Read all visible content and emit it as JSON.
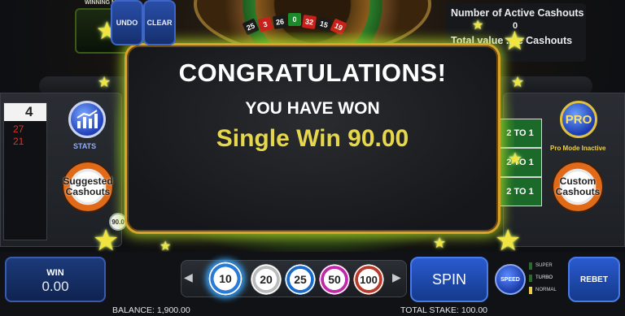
{
  "header": {
    "winning_number_label": "WINNING NUMBER",
    "wheel_numbers": [
      {
        "n": "25",
        "color": "#1a1a1a"
      },
      {
        "n": "3",
        "color": "#c8201a"
      },
      {
        "n": "26",
        "color": "#1a1a1a"
      },
      {
        "n": "0",
        "color": "#1a8a2a"
      },
      {
        "n": "32",
        "color": "#c8201a"
      },
      {
        "n": "15",
        "color": "#1a1a1a"
      },
      {
        "n": "19",
        "color": "#c8201a"
      }
    ],
    "cashouts": {
      "active_label": "Number of Active Cashouts",
      "active_count": "0",
      "total_label": "Total value ... e Cashouts"
    }
  },
  "left_panel": {
    "last_number": "4",
    "history": [
      "27",
      "21"
    ],
    "stats_label": "STATS",
    "suggested_label_1": "Suggested",
    "suggested_label_2": "Cashouts",
    "chip_value": "90.0"
  },
  "right_panel": {
    "pro_label": "PRO",
    "pro_mode_text": "Pro Mode Inactive",
    "to_one": [
      "2 TO 1",
      "2 TO 1",
      "2 TO 1"
    ],
    "custom_label_1": "Custom",
    "custom_label_2": "Cashouts"
  },
  "overlay": {
    "title": "CONGRATULATIONS!",
    "subtitle": "YOU HAVE WON",
    "amount_text": "Single Win 90.00"
  },
  "bottom": {
    "win_label": "WIN",
    "win_value": "0.00",
    "undo_label": "UNDO",
    "clear_label": "CLEAR",
    "chips": [
      "10",
      "20",
      "25",
      "50",
      "100"
    ],
    "selected_chip": "10",
    "spin_label": "SPIN",
    "speed_label": "SPEED",
    "speed_options": [
      "SUPER TURBO",
      "TURBO",
      "NORMAL"
    ],
    "speed_selected": "NORMAL",
    "rebet_label": "REBET",
    "balance_text": "BALANCE: 1,900.00",
    "stake_text": "TOTAL STAKE: 100.00"
  },
  "colors": {
    "overlay_border": "#d8a42a",
    "win_amount": "#e6d84a",
    "accent_blue": "#2a5ad0",
    "glow_green": "#78dc28"
  }
}
